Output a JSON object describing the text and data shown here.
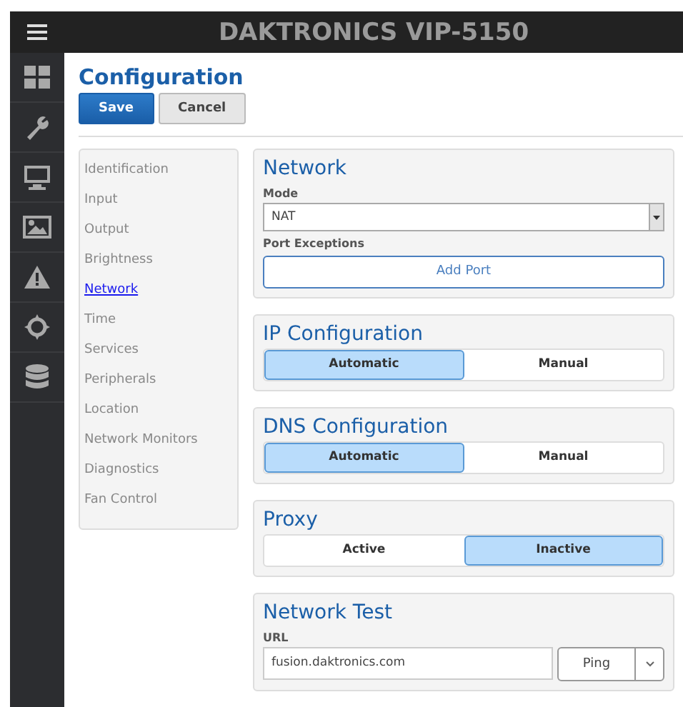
{
  "header": {
    "title": "DAKTRONICS VIP-5150"
  },
  "page": {
    "title": "Configuration",
    "buttons": [
      {
        "label": "Save",
        "kind": "primary"
      },
      {
        "label": "Cancel",
        "kind": "default"
      }
    ]
  },
  "nav": [
    {
      "label": "Identification",
      "selected": false
    },
    {
      "label": "Input",
      "selected": false
    },
    {
      "label": "Output",
      "selected": false
    },
    {
      "label": "Brightness",
      "selected": false
    },
    {
      "label": "Network",
      "selected": true
    },
    {
      "label": "Time",
      "selected": false
    },
    {
      "label": "Services",
      "selected": false
    },
    {
      "label": "Peripherals",
      "selected": false
    },
    {
      "label": "Location",
      "selected": false
    },
    {
      "label": "Network Monitors",
      "selected": false
    },
    {
      "label": "Diagnostics",
      "selected": false
    },
    {
      "label": "Fan Control",
      "selected": false
    }
  ],
  "sections": [
    {
      "kind": "network",
      "title": "Network",
      "mode_label": "Mode",
      "mode_value": "NAT",
      "ports_label": "Port Exceptions",
      "add_button": "Add Port"
    },
    {
      "kind": "toggle",
      "title": "IP Configuration",
      "options": [
        {
          "label": "Automatic",
          "selected": true
        },
        {
          "label": "Manual",
          "selected": false
        }
      ]
    },
    {
      "kind": "toggle",
      "title": "DNS Configuration",
      "options": [
        {
          "label": "Automatic",
          "selected": true
        },
        {
          "label": "Manual",
          "selected": false
        }
      ]
    },
    {
      "kind": "toggle",
      "title": "Proxy",
      "options": [
        {
          "label": "Active",
          "selected": false
        },
        {
          "label": "Inactive",
          "selected": true
        }
      ]
    },
    {
      "kind": "test",
      "title": "Network Test",
      "url_label": "URL",
      "url_value": "fusion.daktronics.com",
      "action": "Ping"
    }
  ]
}
